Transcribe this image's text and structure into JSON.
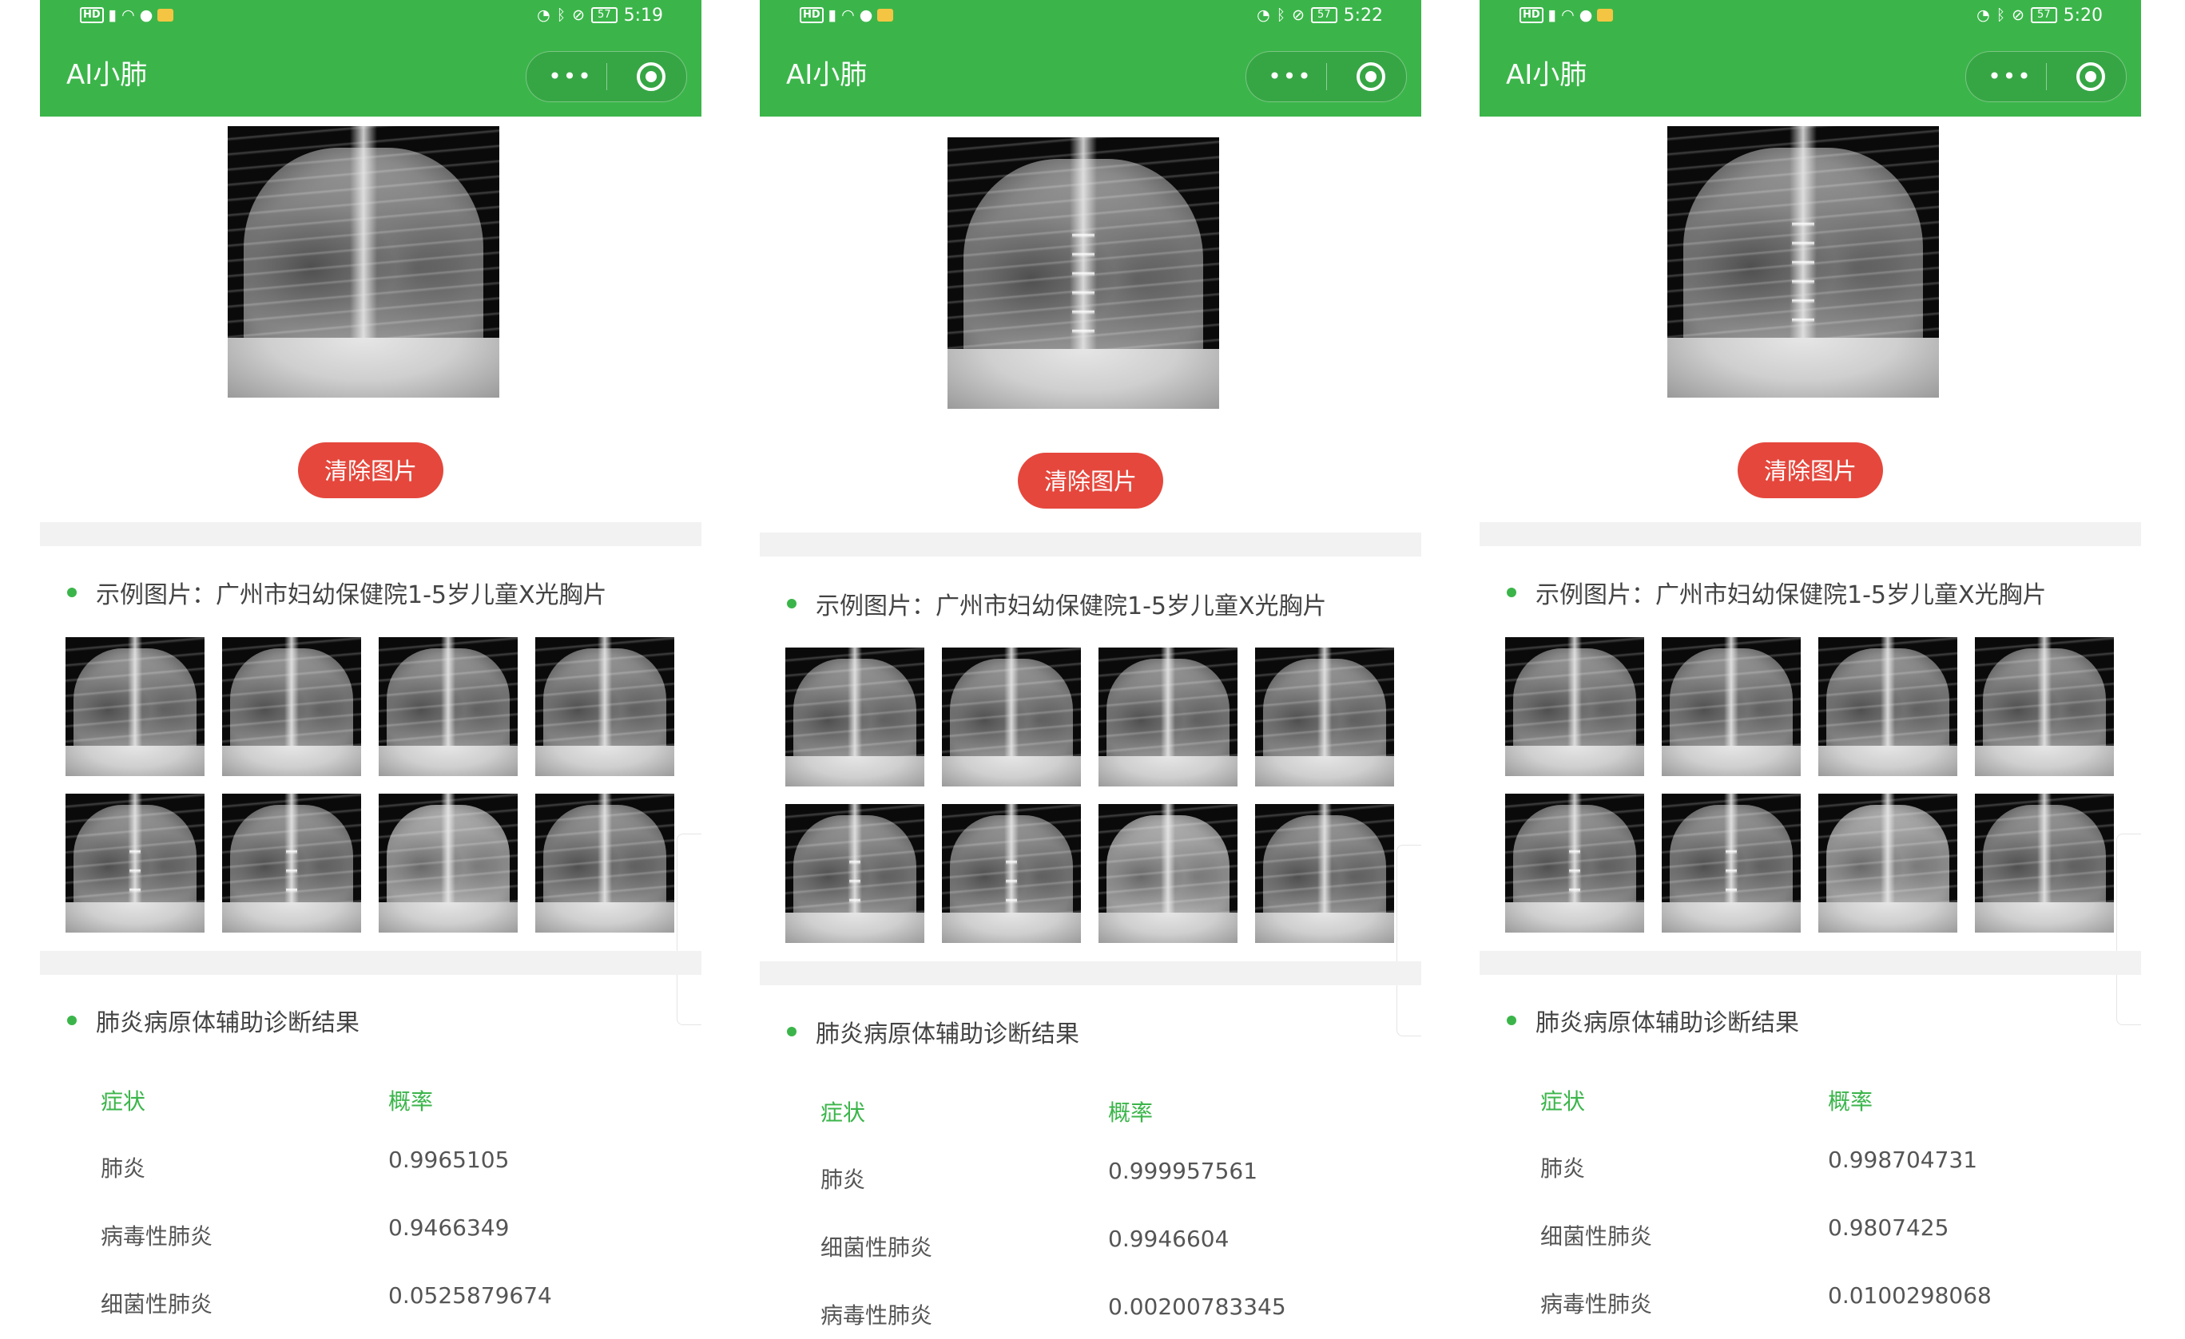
{
  "screens": [
    {
      "status": {
        "time": "5:19",
        "battery": "57"
      },
      "app_title": "AI小肺",
      "capsule": {
        "more_label": "•••"
      },
      "clear_button": "清除图片",
      "examples_title": "示例图片：广州市妇幼保健院1-5岁儿童X光胸片",
      "result_title": "肺炎病原体辅助诊断结果",
      "table": {
        "headers": [
          "症状",
          "概率"
        ],
        "rows": [
          {
            "symptom": "肺炎",
            "prob": "0.9965105"
          },
          {
            "symptom": "病毒性肺炎",
            "prob": "0.9466349"
          },
          {
            "symptom": "细菌性肺炎",
            "prob": "0.0525879674"
          }
        ]
      }
    },
    {
      "status": {
        "time": "5:22",
        "battery": "57"
      },
      "app_title": "AI小肺",
      "capsule": {
        "more_label": "•••"
      },
      "clear_button": "清除图片",
      "examples_title": "示例图片：广州市妇幼保健院1-5岁儿童X光胸片",
      "result_title": "肺炎病原体辅助诊断结果",
      "table": {
        "headers": [
          "症状",
          "概率"
        ],
        "rows": [
          {
            "symptom": "肺炎",
            "prob": "0.999957561"
          },
          {
            "symptom": "细菌性肺炎",
            "prob": "0.9946604"
          },
          {
            "symptom": "病毒性肺炎",
            "prob": "0.00200783345"
          }
        ]
      }
    },
    {
      "status": {
        "time": "5:20",
        "battery": "57"
      },
      "app_title": "AI小肺",
      "capsule": {
        "more_label": "•••"
      },
      "clear_button": "清除图片",
      "examples_title": "示例图片：广州市妇幼保健院1-5岁儿童X光胸片",
      "result_title": "肺炎病原体辅助诊断结果",
      "table": {
        "headers": [
          "症状",
          "概率"
        ],
        "rows": [
          {
            "symptom": "肺炎",
            "prob": "0.998704731"
          },
          {
            "symptom": "细菌性肺炎",
            "prob": "0.9807425"
          },
          {
            "symptom": "病毒性肺炎",
            "prob": "0.0100298068"
          }
        ]
      }
    }
  ],
  "colors": {
    "header_green": "#3bb54a",
    "clear_button_red": "#e5473c",
    "divider_gray": "#f2f2f2",
    "header_text_green": "#3bb54a"
  },
  "icons": [
    "hd-icon",
    "signal-icon",
    "wifi-icon",
    "alarm-icon",
    "bluetooth-icon",
    "mute-icon",
    "battery-icon",
    "more-icon",
    "close-target-icon",
    "chat-icon",
    "message-icon"
  ]
}
